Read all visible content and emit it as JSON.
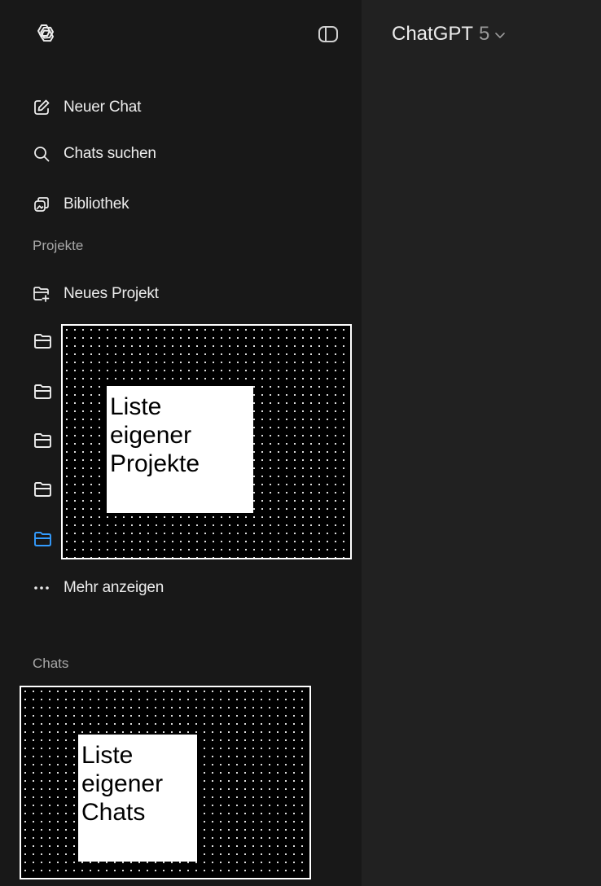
{
  "sidebar": {
    "items": [
      {
        "label": "Neuer Chat",
        "icon": "compose-icon"
      },
      {
        "label": "Chats suchen",
        "icon": "search-icon"
      },
      {
        "label": "Bibliothek",
        "icon": "library-icon"
      }
    ],
    "projects_heading": "Projekte",
    "new_project": {
      "label": "Neues Projekt",
      "icon": "new-folder-icon"
    },
    "project_folders": [
      {
        "icon": "folder-icon",
        "color": "#ececec"
      },
      {
        "icon": "folder-icon",
        "color": "#ececec"
      },
      {
        "icon": "folder-icon",
        "color": "#ececec"
      },
      {
        "icon": "folder-icon",
        "color": "#ececec"
      },
      {
        "icon": "folder-icon",
        "color": "#339cff",
        "active": true
      }
    ],
    "more": {
      "label": "Mehr anzeigen",
      "icon": "more-icon"
    },
    "chats_heading": "Chats"
  },
  "annotations": {
    "projects": [
      "Liste",
      "eigener",
      "Projekte"
    ],
    "chats": [
      "Liste",
      "eigener",
      "Chats"
    ]
  },
  "header": {
    "model_name": "ChatGPT",
    "model_version": "5"
  },
  "colors": {
    "sidebar_bg": "#181818",
    "main_bg": "#212121",
    "text": "#ececec",
    "muted": "#a8a8a8",
    "active_folder": "#339cff"
  }
}
